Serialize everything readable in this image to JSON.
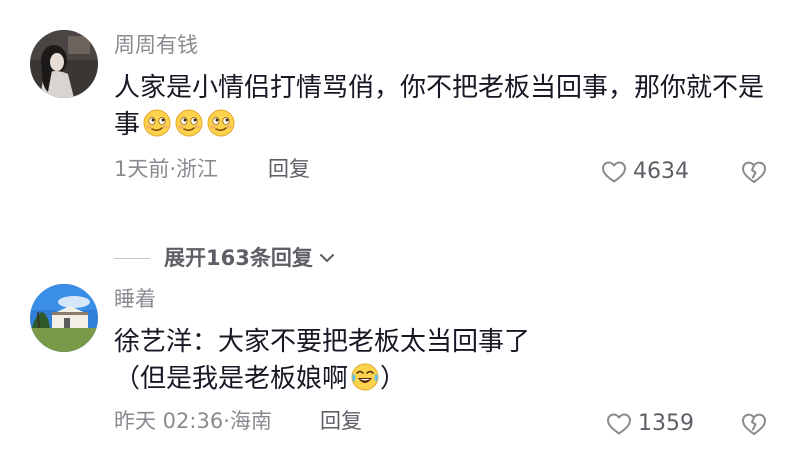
{
  "comments": [
    {
      "username": "周周有钱",
      "text": "人家是小情侣打情骂俏，你不把老板当回事，那你就不是事",
      "emojis": [
        "smirk-emoji",
        "smirk-emoji",
        "smirk-emoji"
      ],
      "time_location": "1天前·浙江",
      "reply_label": "回复",
      "likes": "4634"
    },
    {
      "username": "睡着",
      "text_line1": "徐艺洋：大家不要把老板太当回事了",
      "text_line2_prefix": "（但是我是老板娘啊",
      "text_line2_suffix": "）",
      "emojis": [
        "laugh-cry-emoji"
      ],
      "time_location": "昨天 02:36·海南",
      "reply_label": "回复",
      "likes": "1359"
    }
  ],
  "expand_replies": {
    "label": "展开163条回复"
  },
  "colors": {
    "primary_text": "#161823",
    "secondary_text": "#8a8b91",
    "action_text": "#5e5f66",
    "divider": "#c8c9cc"
  }
}
